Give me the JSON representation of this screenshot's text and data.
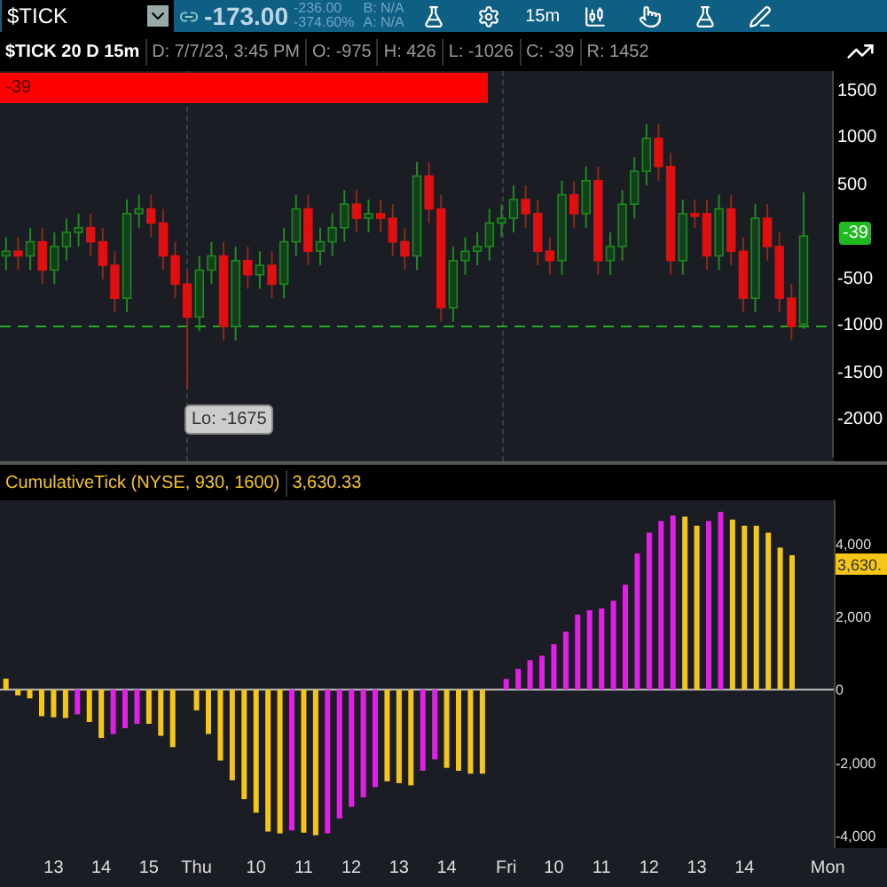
{
  "toolbar": {
    "symbol": "$TICK",
    "last": "-173.00",
    "change": "-236.00",
    "change_pct": "-374.60%",
    "bid": "B: N/A",
    "ask": "A: N/A",
    "interval": "15m"
  },
  "price_panel": {
    "title": "$TICK 20 D 15m",
    "fields": [
      "D: 7/7/23, 3:45 PM",
      "O: -975",
      "H: 426",
      "L: -1026",
      "C: -39",
      "R: 1452"
    ],
    "bar": {
      "label": "-39",
      "level": 0.585
    },
    "last_badge": "-39",
    "low_label": "Lo: -1675",
    "chart_data": {
      "type": "candlestick",
      "ylim": [
        -2396,
        1717
      ],
      "ref_lines": [
        {
          "axis": "y",
          "value": -1000,
          "color": "#1fb01f"
        }
      ],
      "yticks": [
        {
          "value": 1500,
          "label": "1500"
        },
        {
          "value": 1000,
          "label": "1000"
        },
        {
          "value": 500,
          "label": "500"
        },
        {
          "value": -500,
          "label": "-500"
        },
        {
          "value": -1000,
          "label": "-1000"
        },
        {
          "value": -1500,
          "label": "-1500"
        },
        {
          "value": -2000,
          "label": "-2000"
        }
      ],
      "categories": [
        null,
        null,
        null,
        null,
        null,
        null,
        null,
        null,
        null,
        null,
        null,
        null,
        null,
        null,
        null,
        null,
        null,
        null,
        null,
        null,
        null,
        null,
        null,
        null,
        null,
        null,
        null,
        null,
        null,
        null,
        null,
        null,
        null,
        null,
        null,
        null,
        null,
        null,
        null,
        null,
        null,
        null,
        null,
        null,
        null,
        null,
        null,
        null,
        null,
        null,
        null,
        null,
        null,
        null,
        null,
        null,
        null,
        null,
        null,
        null,
        null,
        null,
        null,
        null,
        null,
        null,
        null
      ],
      "ohlc": [
        [
          -250,
          -50,
          -400,
          -200
        ],
        [
          -200,
          -50,
          -400,
          -250
        ],
        [
          -250,
          50,
          -400,
          -100
        ],
        [
          -100,
          50,
          -550,
          -400
        ],
        [
          -400,
          0,
          -550,
          -150
        ],
        [
          -150,
          150,
          -300,
          0
        ],
        [
          0,
          200,
          -150,
          50
        ],
        [
          50,
          200,
          -250,
          -100
        ],
        [
          -100,
          50,
          -500,
          -350
        ],
        [
          -350,
          -200,
          -850,
          -700
        ],
        [
          -700,
          350,
          -850,
          200
        ],
        [
          200,
          400,
          50,
          250
        ],
        [
          250,
          400,
          -50,
          100
        ],
        [
          100,
          250,
          -400,
          -250
        ],
        [
          -250,
          -100,
          -700,
          -550
        ],
        [
          -550,
          -400,
          -1675,
          -900
        ],
        [
          -900,
          -250,
          -1050,
          -400
        ],
        [
          -400,
          -100,
          -550,
          -250
        ],
        [
          -250,
          -100,
          -1150,
          -1000
        ],
        [
          -1000,
          -150,
          -1150,
          -300
        ],
        [
          -300,
          -150,
          -600,
          -450
        ],
        [
          -450,
          -200,
          -600,
          -350
        ],
        [
          -350,
          -200,
          -700,
          -550
        ],
        [
          -550,
          50,
          -700,
          -100
        ],
        [
          -100,
          400,
          -250,
          250
        ],
        [
          250,
          400,
          -350,
          -200
        ],
        [
          -200,
          50,
          -350,
          -100
        ],
        [
          -100,
          200,
          -250,
          50
        ],
        [
          50,
          450,
          -100,
          300
        ],
        [
          300,
          450,
          0,
          150
        ],
        [
          150,
          350,
          0,
          200
        ],
        [
          200,
          350,
          0,
          150
        ],
        [
          150,
          300,
          -250,
          -100
        ],
        [
          -100,
          50,
          -400,
          -250
        ],
        [
          -250,
          750,
          -400,
          600
        ],
        [
          600,
          750,
          100,
          250
        ],
        [
          250,
          400,
          -950,
          -800
        ],
        [
          -800,
          -150,
          -950,
          -300
        ],
        [
          -300,
          -50,
          -450,
          -200
        ],
        [
          -200,
          0,
          -350,
          -150
        ],
        [
          -150,
          250,
          -300,
          100
        ],
        [
          100,
          300,
          -50,
          150
        ],
        [
          150,
          500,
          0,
          350
        ],
        [
          350,
          500,
          50,
          200
        ],
        [
          200,
          350,
          -350,
          -200
        ],
        [
          -200,
          -50,
          -450,
          -300
        ],
        [
          -300,
          550,
          -450,
          400
        ],
        [
          400,
          550,
          50,
          200
        ],
        [
          200,
          700,
          50,
          550
        ],
        [
          550,
          700,
          -450,
          -300
        ],
        [
          -300,
          0,
          -450,
          -150
        ],
        [
          -150,
          450,
          -300,
          300
        ],
        [
          300,
          800,
          150,
          650
        ],
        [
          650,
          1150,
          500,
          1000
        ],
        [
          1000,
          1150,
          550,
          700
        ],
        [
          700,
          850,
          -450,
          -300
        ],
        [
          -300,
          350,
          -450,
          200
        ],
        [
          200,
          350,
          50,
          200
        ],
        [
          200,
          350,
          -400,
          -250
        ],
        [
          -250,
          400,
          -400,
          250
        ],
        [
          250,
          400,
          -350,
          -200
        ],
        [
          -200,
          -50,
          -850,
          -700
        ],
        [
          -700,
          300,
          -850,
          150
        ],
        [
          150,
          300,
          -300,
          -150
        ],
        [
          -150,
          0,
          -850,
          -700
        ],
        [
          -700,
          -550,
          -1150,
          -1000
        ],
        [
          -975,
          426,
          -1026,
          -39
        ]
      ]
    }
  },
  "study_panel": {
    "title": "CumulativeTick (NYSE, 930, 1600)",
    "value": "3,630.33",
    "badge": "3,630.",
    "chart_data": {
      "type": "bar",
      "stacked": true,
      "ylim": [
        -4350,
        5200
      ],
      "categories": [
        null,
        null,
        null,
        null,
        "13",
        null,
        null,
        null,
        "14",
        null,
        null,
        null,
        "15",
        null,
        null,
        null,
        "Thu",
        null,
        null,
        null,
        null,
        "10",
        null,
        null,
        null,
        "11",
        null,
        null,
        null,
        "12",
        null,
        null,
        null,
        "13",
        null,
        null,
        null,
        "14",
        null,
        null,
        null,
        null,
        "Fri",
        null,
        null,
        null,
        "10",
        null,
        null,
        null,
        "11",
        null,
        null,
        null,
        "12",
        null,
        null,
        null,
        "13",
        null,
        null,
        null,
        "14",
        null,
        null,
        null,
        null,
        null,
        null,
        "Mon"
      ],
      "series": [
        {
          "color": "#f5c518",
          "values": [
            300,
            -160,
            -240,
            -730,
            -760,
            -780,
            null,
            -890,
            -1330,
            null,
            null,
            null,
            -940,
            -1270,
            -1580,
            null,
            -570,
            -1220,
            -1950,
            -2490,
            -3010,
            -3380,
            -3900,
            -3950,
            null,
            -3930,
            -4000,
            null,
            null,
            null,
            null,
            null,
            -2520,
            -2570,
            -2630,
            null,
            null,
            -2150,
            -2230,
            -2310,
            -2310,
            null,
            null,
            null,
            null,
            null,
            null,
            null,
            null,
            null,
            null,
            null,
            null,
            null,
            null,
            null,
            null,
            4750,
            4500,
            null,
            null,
            4670,
            4500,
            4500,
            4310,
            3900,
            3690,
            null,
            null,
            null
          ]
        },
        {
          "color": "#e21fe6",
          "values": [
            null,
            null,
            null,
            null,
            null,
            null,
            -680,
            null,
            null,
            -1220,
            -1060,
            -940,
            null,
            null,
            null,
            null,
            null,
            null,
            null,
            null,
            null,
            null,
            null,
            null,
            -3870,
            null,
            null,
            -3950,
            -3540,
            -3220,
            -2960,
            -2680,
            null,
            null,
            null,
            -2230,
            -1920,
            null,
            null,
            null,
            null,
            null,
            290,
            570,
            810,
            930,
            1250,
            1590,
            2060,
            2180,
            2230,
            2440,
            2880,
            3740,
            4310,
            4630,
            4780,
            null,
            null,
            4630,
            4880,
            null,
            null,
            null,
            null,
            null,
            null,
            null,
            null,
            null
          ]
        }
      ],
      "yticks": [
        {
          "value": -4000,
          "label": "-4,000"
        },
        {
          "value": -2000,
          "label": "-2,000"
        },
        {
          "value": 0,
          "label": "0"
        },
        {
          "value": 2000,
          "label": "2,000"
        },
        {
          "value": 4000,
          "label": "4,000"
        }
      ]
    }
  }
}
